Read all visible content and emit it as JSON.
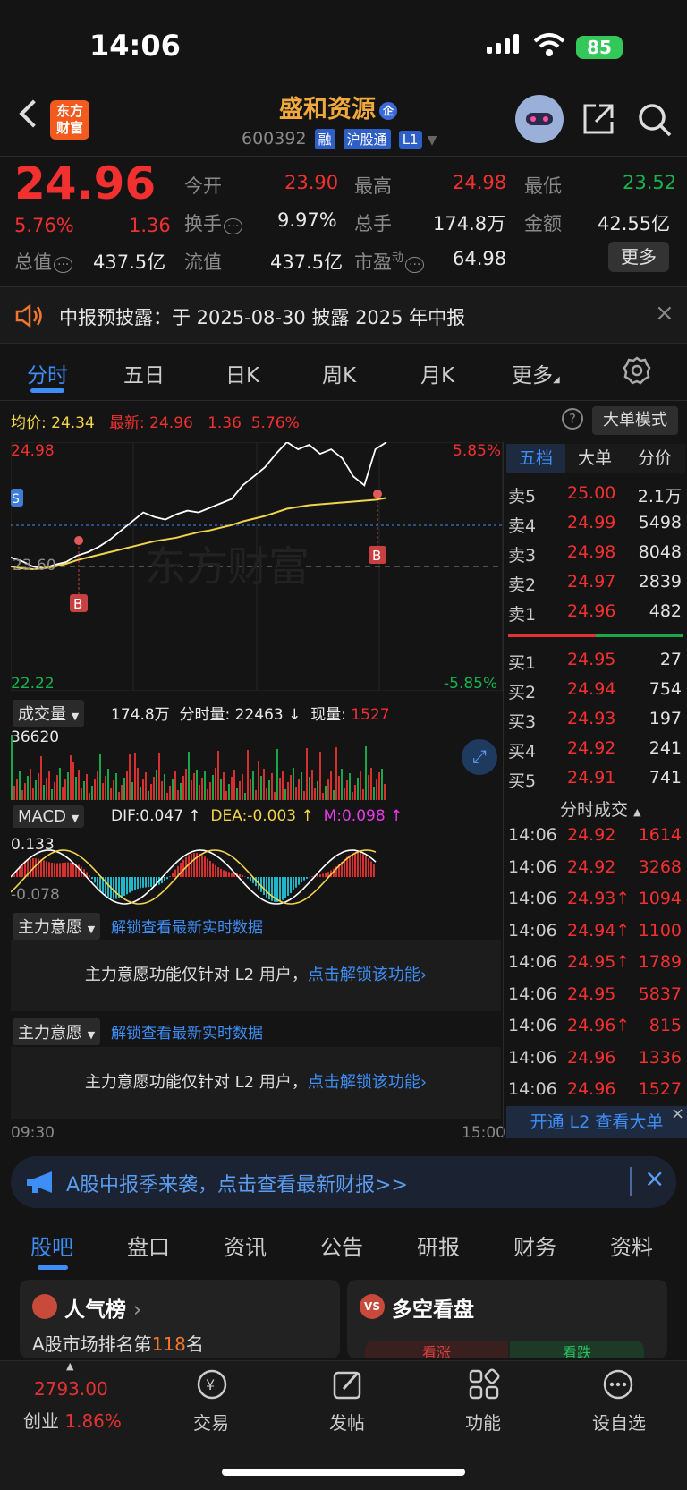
{
  "status": {
    "time": "14:06",
    "battery": "85"
  },
  "header": {
    "logo": "东方\n财富",
    "name": "盛和资源",
    "name_badge": "企",
    "code": "600392",
    "badges": [
      "融",
      "沪股通",
      "L1"
    ]
  },
  "quote": {
    "price": "24.96",
    "pct": "5.76%",
    "chg": "1.36",
    "open_label": "今开",
    "open": "23.90",
    "high_label": "最高",
    "high": "24.98",
    "low_label": "最低",
    "low": "23.52",
    "turnover_label": "换手",
    "turnover": "9.97%",
    "vol_label": "总手",
    "vol": "174.8万",
    "amount_label": "金额",
    "amount": "42.55亿",
    "mktcap_label": "总值",
    "mktcap": "437.5亿",
    "float_label": "流值",
    "float": "437.5亿",
    "pe_label": "市盈",
    "pe_sup": "动",
    "pe": "64.98",
    "more": "更多"
  },
  "notice": {
    "text": "中报预披露：于 2025-08-30 披露 2025 年中报"
  },
  "tabs": [
    "分时",
    "五日",
    "日K",
    "周K",
    "月K",
    "更多"
  ],
  "chart_info": {
    "avg_label": "均价:",
    "avg": "24.34",
    "last_label": "最新:",
    "last": "24.96",
    "chg": "1.36",
    "pct": "5.76%",
    "mode": "大单模式"
  },
  "chart_data": {
    "type": "line",
    "ylim": [
      22.22,
      24.98
    ],
    "y_top": "24.98",
    "y_bottom": "22.22",
    "y_mid": "23.60",
    "pct_top": "5.85%",
    "pct_bottom": "-5.85%",
    "x_start": "09:30",
    "x_end": "15:00",
    "series": [
      {
        "values": [
          23.7,
          23.66,
          23.6,
          23.58,
          23.62,
          23.65,
          23.72,
          23.76,
          23.82,
          23.9,
          24.0,
          24.1,
          24.2,
          24.15,
          24.12,
          24.18,
          24.22,
          24.2,
          24.25,
          24.3,
          24.35,
          24.5,
          24.6,
          24.7,
          24.85,
          24.98,
          24.9,
          24.95,
          24.85,
          24.9,
          24.8,
          24.6,
          24.5,
          24.9,
          24.98
        ]
      },
      {
        "values": [
          23.6,
          23.58,
          23.57,
          23.58,
          23.6,
          23.63,
          23.67,
          23.7,
          23.73,
          23.76,
          23.79,
          23.82,
          23.85,
          23.88,
          23.9,
          23.92,
          23.95,
          23.98,
          24.0,
          24.03,
          24.06,
          24.1,
          24.13,
          24.16,
          24.2,
          24.24,
          24.26,
          24.28,
          24.29,
          24.3,
          24.31,
          24.32,
          24.33,
          24.34,
          24.36
        ]
      }
    ]
  },
  "volume": {
    "label": "成交量",
    "total": "174.8万",
    "minute_label": "分时量:",
    "minute": "22463",
    "now_label": "现量:",
    "now": "1527",
    "max": "36620"
  },
  "macd": {
    "label": "MACD",
    "dif": "DIF:0.047 ↑",
    "dea": "DEA:-0.003 ↑",
    "m": "M:0.098 ↑",
    "top": "0.133",
    "bottom": "-0.078"
  },
  "main_force": {
    "label": "主力意愿",
    "unlock": "解锁查看最新实时数据",
    "msg": "主力意愿功能仅针对 L2 用户，",
    "link": "点击解锁该功能"
  },
  "book": {
    "tabs": [
      "五档",
      "大单",
      "分价"
    ],
    "asks": [
      {
        "k": "卖5",
        "p": "25.00",
        "v": "2.1万"
      },
      {
        "k": "卖4",
        "p": "24.99",
        "v": "5498"
      },
      {
        "k": "卖3",
        "p": "24.98",
        "v": "8048"
      },
      {
        "k": "卖2",
        "p": "24.97",
        "v": "2839"
      },
      {
        "k": "卖1",
        "p": "24.96",
        "v": "482"
      }
    ],
    "bids": [
      {
        "k": "买1",
        "p": "24.95",
        "v": "27"
      },
      {
        "k": "买2",
        "p": "24.94",
        "v": "754"
      },
      {
        "k": "买3",
        "p": "24.93",
        "v": "197"
      },
      {
        "k": "买4",
        "p": "24.92",
        "v": "241"
      },
      {
        "k": "买5",
        "p": "24.91",
        "v": "741"
      }
    ],
    "trades_label": "分时成交",
    "trades": [
      {
        "t": "14:06",
        "p": "24.92",
        "v": "1614",
        "up": false,
        "red": true
      },
      {
        "t": "14:06",
        "p": "24.92",
        "v": "3268",
        "up": false,
        "red": true
      },
      {
        "t": "14:06",
        "p": "24.93↑",
        "v": "1094",
        "up": true,
        "red": true
      },
      {
        "t": "14:06",
        "p": "24.94↑",
        "v": "1100",
        "up": true,
        "red": true
      },
      {
        "t": "14:06",
        "p": "24.95↑",
        "v": "1789",
        "up": true,
        "red": true
      },
      {
        "t": "14:06",
        "p": "24.95",
        "v": "5837",
        "up": false,
        "red": true
      },
      {
        "t": "14:06",
        "p": "24.96↑",
        "v": "815",
        "up": true,
        "red": true
      },
      {
        "t": "14:06",
        "p": "24.96",
        "v": "1336",
        "up": false,
        "red": true
      },
      {
        "t": "14:06",
        "p": "24.96",
        "v": "1527",
        "up": false,
        "red": true
      }
    ],
    "l2": "开通 L2 查看大单"
  },
  "banner": {
    "text": "A股中报季来袭，点击查看最新财报>>"
  },
  "bottom_tabs": [
    "股吧",
    "盘口",
    "资讯",
    "公告",
    "研报",
    "财务",
    "资料"
  ],
  "cards": {
    "hot": "人气榜",
    "hot_sub_pre": "A股市场排名第",
    "hot_rank": "118",
    "hot_sub_post": "名",
    "vs": "多空看盘",
    "vs_up": "看涨",
    "vs_down": "看跌"
  },
  "nav": {
    "index_value": "2793.00",
    "index_name": "创业",
    "index_pct": "1.86%",
    "items": [
      "交易",
      "发帖",
      "功能",
      "设自选"
    ]
  }
}
